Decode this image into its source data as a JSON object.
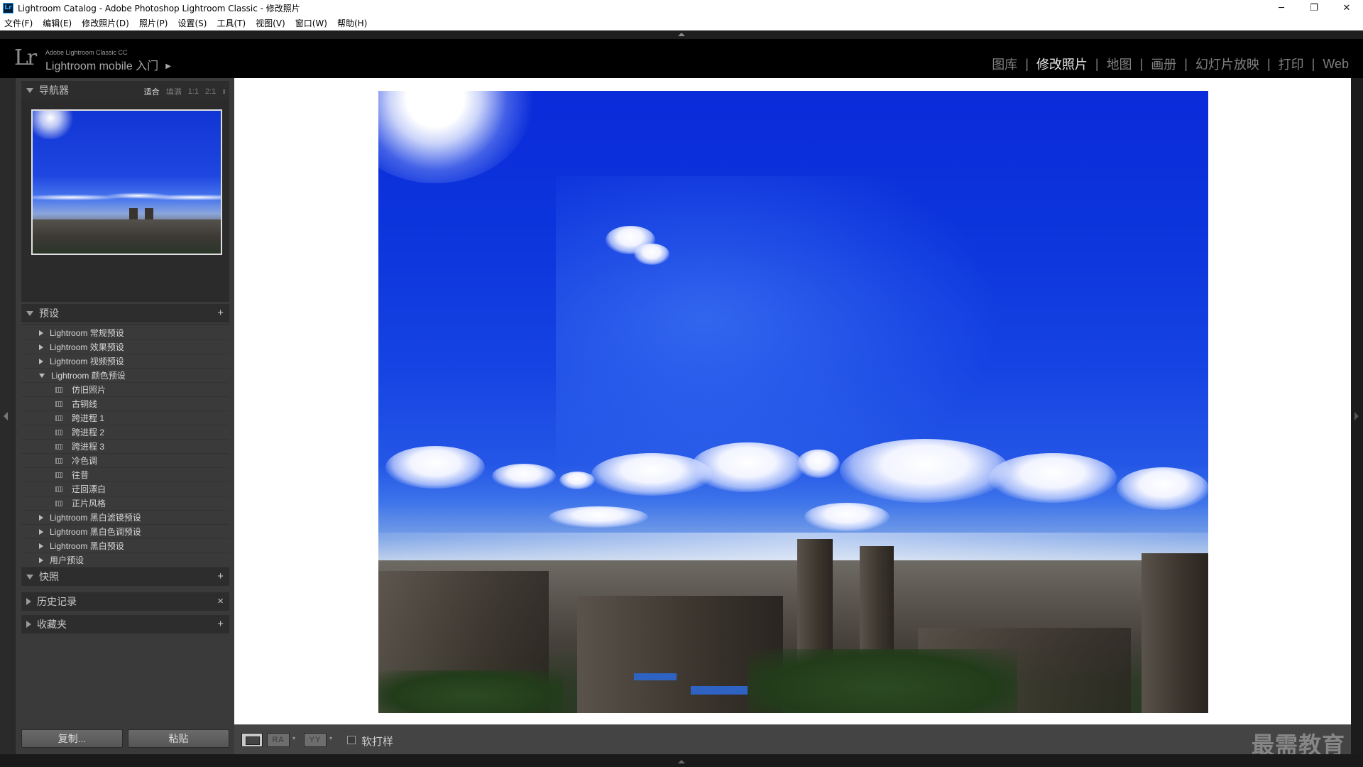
{
  "window": {
    "app_icon": "Lr",
    "title": "Lightroom Catalog - Adobe Photoshop Lightroom Classic - 修改照片",
    "minimize": "─",
    "restore": "❐",
    "close": "✕"
  },
  "menubar": [
    "文件(F)",
    "编辑(E)",
    "修改照片(D)",
    "照片(P)",
    "设置(S)",
    "工具(T)",
    "视图(V)",
    "窗口(W)",
    "帮助(H)"
  ],
  "identity": {
    "logo": "Lr",
    "brand_small": "Adobe Lightroom Classic CC",
    "brand_main": "Lightroom mobile 入门",
    "brand_arrow": "▶"
  },
  "modules": {
    "items": [
      "图库",
      "修改照片",
      "地图",
      "画册",
      "幻灯片放映",
      "打印",
      "Web"
    ],
    "active": "修改照片",
    "separator": "|"
  },
  "navigator": {
    "title": "导航器",
    "zoom_options": [
      "适合",
      "填满",
      "1:1",
      "2:1"
    ],
    "zoom_active": "适合",
    "zoom_stepper": "⇕"
  },
  "presets": {
    "title": "预设",
    "add": "+",
    "groups": [
      {
        "label": "Lightroom 常规预设",
        "open": false
      },
      {
        "label": "Lightroom 效果预设",
        "open": false
      },
      {
        "label": "Lightroom 视频预设",
        "open": false
      },
      {
        "label": "Lightroom 颜色预设",
        "open": true
      },
      {
        "label": "仿旧照片",
        "child": true
      },
      {
        "label": "古铜线",
        "child": true
      },
      {
        "label": "跨进程 1",
        "child": true
      },
      {
        "label": "跨进程 2",
        "child": true
      },
      {
        "label": "跨进程 3",
        "child": true
      },
      {
        "label": "冷色调",
        "child": true
      },
      {
        "label": "往昔",
        "child": true
      },
      {
        "label": "迂回漂白",
        "child": true
      },
      {
        "label": "正片风格",
        "child": true
      },
      {
        "label": "Lightroom 黑白滤镜预设",
        "open": false
      },
      {
        "label": "Lightroom 黑白色调预设",
        "open": false
      },
      {
        "label": "Lightroom 黑白预设",
        "open": false
      },
      {
        "label": "用户预设",
        "open": false
      }
    ]
  },
  "snapshots": {
    "title": "快照",
    "add": "+"
  },
  "history": {
    "title": "历史记录",
    "clear": "×"
  },
  "collections": {
    "title": "收藏夹",
    "add": "+"
  },
  "footer": {
    "copy": "复制...",
    "paste": "粘贴"
  },
  "toolbar": {
    "ab_label": "RA",
    "yy_label": "YY",
    "dropdown": "▾",
    "soft_proof": "软打样",
    "soft_proof_checked": false
  },
  "watermark": "最需教育"
}
